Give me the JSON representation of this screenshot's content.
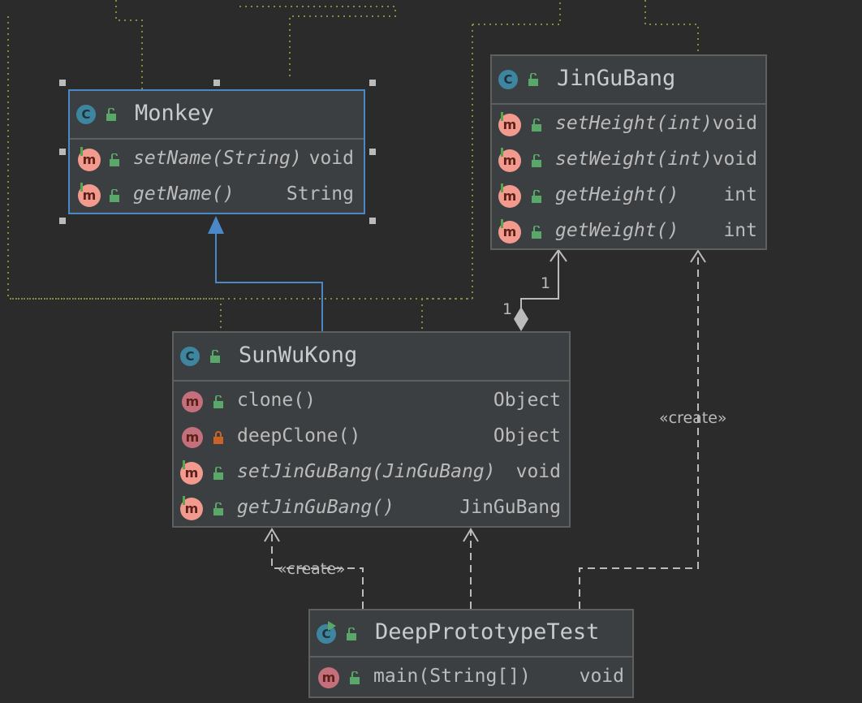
{
  "classes": {
    "monkey": {
      "name": "Monkey",
      "methods": [
        {
          "name": "setName(String)",
          "type": "void"
        },
        {
          "name": "getName()",
          "type": "String"
        }
      ]
    },
    "jingubang": {
      "name": "JinGuBang",
      "methods": [
        {
          "name": "setHeight(int)",
          "type": "void"
        },
        {
          "name": "setWeight(int)",
          "type": "void"
        },
        {
          "name": "getHeight()",
          "type": "int"
        },
        {
          "name": "getWeight()",
          "type": "int"
        }
      ]
    },
    "sunwukong": {
      "name": "SunWuKong",
      "methods": [
        {
          "name": "clone()",
          "type": "Object"
        },
        {
          "name": "deepClone()",
          "type": "Object"
        },
        {
          "name": "setJinGuBang(JinGuBang)",
          "type": "void"
        },
        {
          "name": "getJinGuBang()",
          "type": "JinGuBang"
        }
      ]
    },
    "deepprototypetest": {
      "name": "DeepPrototypeTest",
      "methods": [
        {
          "name": "main(String[])",
          "type": "void"
        }
      ]
    }
  },
  "icons": {
    "class": "C",
    "method": "m"
  },
  "relations": {
    "multiplicity_target": "1",
    "multiplicity_source": "1",
    "create_label_right": "«create»",
    "create_label_left": "«create»"
  },
  "colors": {
    "background": "#2b2b2b",
    "box": "#3c3f41",
    "border": "#5e6060",
    "selection": "#4a88c7",
    "class_icon": "#3e86a0",
    "method_icon": "#f29a8e",
    "method_icon_plain": "#c4707c",
    "public_lock": "#59a869",
    "private_lock": "#c86428",
    "dotted_lines": "#8a8a3a"
  }
}
